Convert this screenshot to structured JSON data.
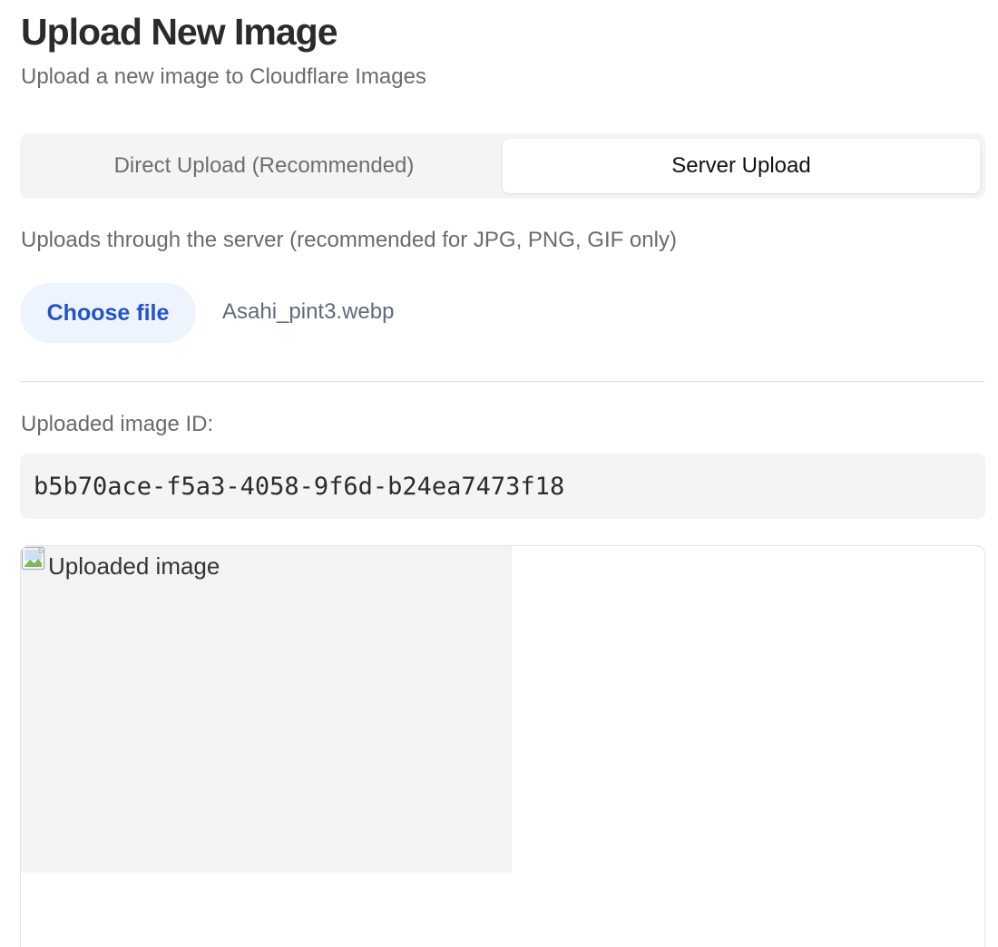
{
  "header": {
    "title": "Upload New Image",
    "subtitle": "Upload a new image to Cloudflare Images"
  },
  "tabs": [
    {
      "label": "Direct Upload (Recommended)",
      "active": false
    },
    {
      "label": "Server Upload",
      "active": true
    }
  ],
  "upload": {
    "hint": "Uploads through the server (recommended for JPG, PNG, GIF only)",
    "choose_file_label": "Choose file",
    "selected_file": "Asahi_pint3.webp"
  },
  "result": {
    "id_label": "Uploaded image ID:",
    "image_id": "b5b70ace-f5a3-4058-9f6d-b24ea7473f18",
    "image_alt": "Uploaded image",
    "image_icon": "broken-image-icon"
  },
  "colors": {
    "accent": "#2452c9",
    "accent_bg": "#eef4fd",
    "muted_text": "#6b6b6b",
    "panel_bg": "#f4f4f3"
  }
}
